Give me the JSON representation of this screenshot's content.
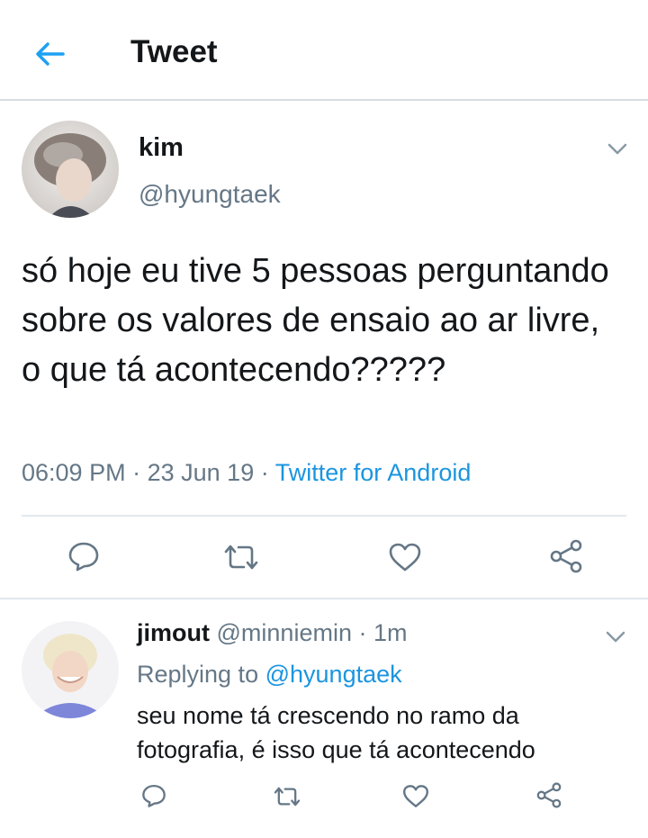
{
  "header": {
    "title": "Tweet"
  },
  "tweet": {
    "author_name": "kim",
    "author_handle": "@hyungtaek",
    "text": "só hoje eu tive 5 pessoas perguntando sobre os valores de ensaio ao ar livre, o que tá acontecendo?????",
    "time": "06:09 PM",
    "date": "23 Jun 19",
    "source": "Twitter for Android",
    "sep": "·"
  },
  "reply": {
    "author_name": "jimout",
    "author_handle": "@minniemin",
    "age": "1m",
    "sep": "·",
    "replying_prefix": "Replying to",
    "replying_to": "@hyungtaek",
    "text": "seu nome tá crescendo no ramo da fotografia, é isso que tá acontecendo"
  },
  "icons": [
    "back-arrow-icon",
    "chevron-down-icon",
    "reply-icon",
    "retweet-icon",
    "like-icon",
    "share-icon"
  ],
  "colors": {
    "accent": "#1b95e0",
    "text": "#14171a",
    "muted": "#657786",
    "divider": "#e1e8ed"
  }
}
